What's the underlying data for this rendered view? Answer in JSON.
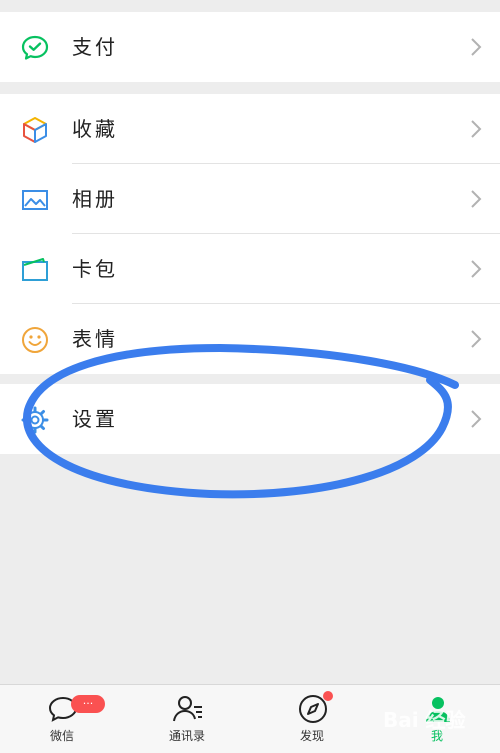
{
  "menu": {
    "pay": {
      "label": "支付",
      "icon": "wechat-pay-icon"
    },
    "favorites": {
      "label": "收藏",
      "icon": "cube-icon"
    },
    "album": {
      "label": "相册",
      "icon": "image-icon"
    },
    "cards": {
      "label": "卡包",
      "icon": "wallet-icon"
    },
    "stickers": {
      "label": "表情",
      "icon": "smiley-icon"
    },
    "settings": {
      "label": "设置",
      "icon": "gear-icon"
    }
  },
  "tabbar": {
    "chats": {
      "label": "微信",
      "badge": "···"
    },
    "contacts": {
      "label": "通讯录"
    },
    "discover": {
      "label": "发现"
    },
    "me": {
      "label": "我"
    }
  },
  "watermark": "Bai 经验",
  "colors": {
    "accent_green": "#07c160",
    "badge_red": "#fa5151",
    "annotation_blue": "#3b7ded"
  }
}
